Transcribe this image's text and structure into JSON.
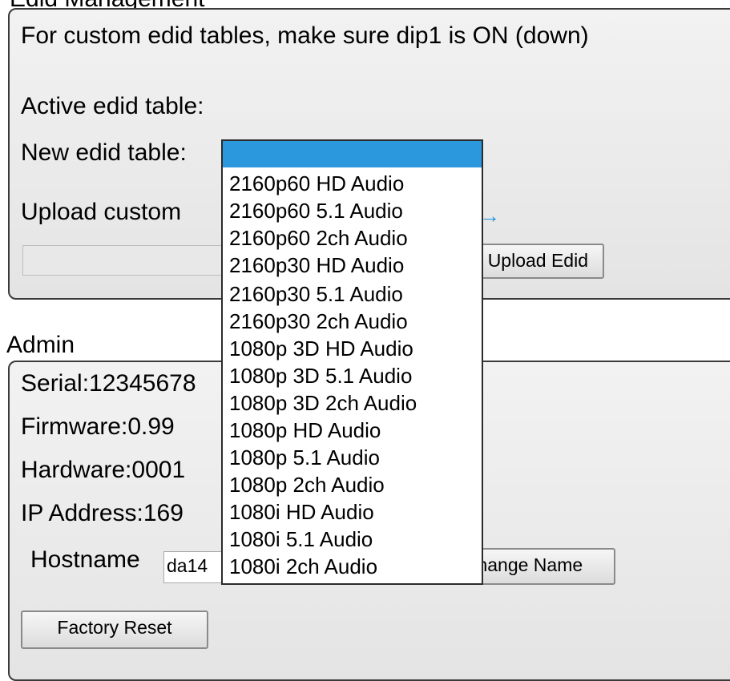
{
  "edid": {
    "legend": "Edid Management",
    "note": "For custom edid tables, make sure dip1 is ON (down)",
    "active_label": "Active edid table:",
    "new_label": "New edid table:",
    "upload_label": "Upload custom",
    "upload_button": "Upload Edid",
    "selected_value": "",
    "options": [
      "2160p60 HD Audio",
      "2160p60 5.1 Audio",
      "2160p60 2ch Audio",
      "2160p30 HD Audio",
      "2160p30 5.1 Audio",
      "2160p30 2ch Audio",
      "1080p 3D HD Audio",
      "1080p 3D 5.1 Audio",
      "1080p 3D 2ch Audio",
      "1080p HD Audio",
      "1080p 5.1 Audio",
      "1080p 2ch Audio",
      "1080i HD Audio",
      "1080i 5.1 Audio",
      "1080i 2ch Audio"
    ]
  },
  "admin": {
    "legend": "Admin",
    "serial": "Serial:12345678",
    "firmware": "Firmware:0.99",
    "hardware": "Hardware:0001",
    "ip": "IP Address:169",
    "hostname_label": "Hostname",
    "hostname_value": "da14",
    "change_name_button": "Change Name",
    "factory_reset_button": "Factory Reset"
  },
  "colors": {
    "highlight": "#2b97dd",
    "fieldset_border": "#3a3a3a"
  }
}
